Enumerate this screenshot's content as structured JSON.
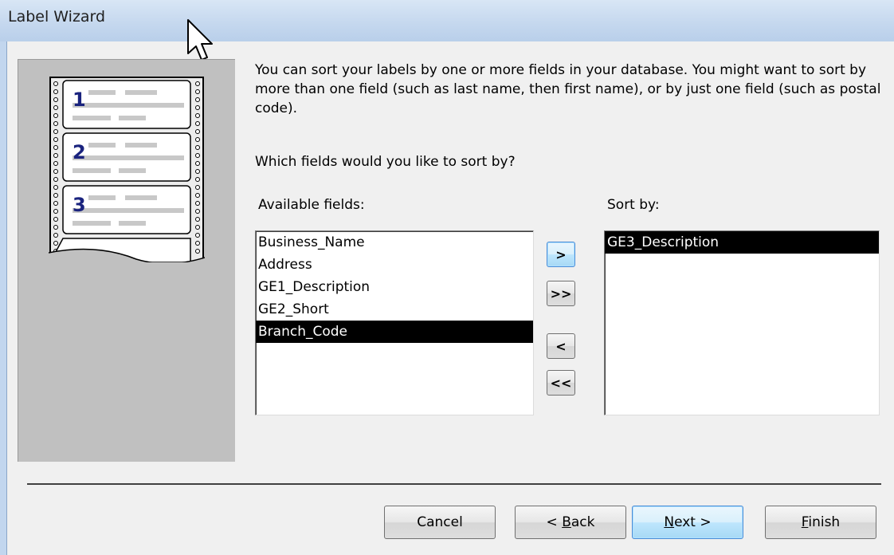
{
  "window": {
    "title": "Label Wizard"
  },
  "illustration": {
    "numbers": [
      "1",
      "2",
      "3"
    ]
  },
  "instructions": {
    "text": "You can sort your labels by one or more fields in your database.  You might want to sort by more than one field (such as last name, then first name), or by just one field (such as postal code).",
    "question": "Which fields would you like to sort by?"
  },
  "available": {
    "label": "Available fields:",
    "items": [
      "Business_Name",
      "Address",
      "GE1_Description",
      "GE2_Short",
      "Branch_Code"
    ],
    "selected_item": "Branch_Code"
  },
  "sort_by": {
    "label": "Sort by:",
    "items": [
      "GE3_Description"
    ],
    "selected_item": "GE3_Description"
  },
  "move_buttons": {
    "add_one": ">",
    "add_all": ">>",
    "remove_one": "<",
    "remove_all": "<<"
  },
  "footer": {
    "cancel": "Cancel",
    "back_prefix": "< ",
    "back_accel": "B",
    "back_rest": "ack",
    "next_accel": "N",
    "next_rest": "ext >",
    "finish_accel": "F",
    "finish_rest": "inish"
  }
}
